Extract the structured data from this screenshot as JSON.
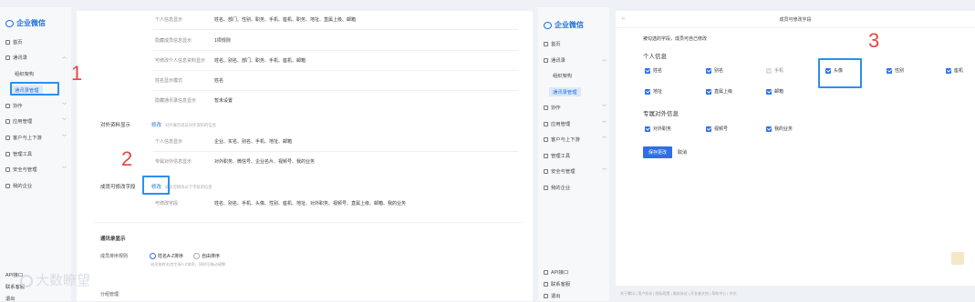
{
  "left": {
    "sidebar": {
      "brand": "企业微信",
      "items": [
        {
          "label": "首页"
        },
        {
          "label": "通讯录"
        },
        {
          "label": "组织架构"
        },
        {
          "label": "通讯录管理"
        },
        {
          "label": "协作"
        },
        {
          "label": "应用管理"
        },
        {
          "label": "客户与上下游"
        },
        {
          "label": "管理工具"
        },
        {
          "label": "安全与管理"
        },
        {
          "label": "我的企业"
        }
      ],
      "bottom": [
        "API接口",
        "联系客服",
        "退出"
      ]
    },
    "rows": [
      {
        "label": "个人信息显示",
        "value": "姓名、部门、性别、职务、手机、座机、职务、地址、直属上级、邮箱"
      },
      {
        "label": "隐藏成员信息显示",
        "value": "1项规则"
      },
      {
        "label": "可修改个人信息资料显示",
        "value": "姓名、别名、部门、职务、手机、座机、邮箱"
      },
      {
        "label": "姓名显示模式",
        "value": "姓名"
      },
      {
        "label": "隐藏通讯录信息显示",
        "value": "暂未设置"
      }
    ],
    "external": {
      "title": "对外资料显示",
      "edit": "修改",
      "hint": "对外展示成员对外资料的信息",
      "rows": [
        {
          "label": "个人信息显示",
          "value": "企业、实名、别名、手机、地址、邮箱"
        },
        {
          "label": "专属对外信息显示",
          "value": "对外职务、微信号、企业名片、视频号、我的业务"
        }
      ]
    },
    "member_edit": {
      "title": "成员可修改字段",
      "edit": "修改",
      "hint": "成员可修改以下字段的信息",
      "row_label": "可修改字段",
      "row_value": "姓名、别名、手机、头像、性别、座机、地址、对外职务、视频号、直属上级、邮箱、我的业务"
    },
    "sort": {
      "title": "通讯录显示",
      "label": "成员排序规则",
      "option1": "姓名A-Z排序",
      "option2": "自由排序",
      "hint": "成员按姓名首字母A-Z排序，同时可拖动调整"
    },
    "watermark": "大数瞭望",
    "bottom_link": "分组管理"
  },
  "annotations": {
    "one": "1",
    "two": "2",
    "three": "3"
  },
  "right": {
    "sidebar": {
      "brand": "企业微信",
      "items": [
        {
          "label": "首页"
        },
        {
          "label": "通讯录"
        },
        {
          "label": "组织架构"
        },
        {
          "label": "通讯录管理"
        },
        {
          "label": "协作"
        },
        {
          "label": "应用管理"
        },
        {
          "label": "客户与上下游"
        },
        {
          "label": "管理工具"
        },
        {
          "label": "安全与管理"
        },
        {
          "label": "我的企业"
        }
      ],
      "bottom": [
        "API接口",
        "联系客服",
        "退出"
      ]
    },
    "header_title": "成员可修改字段",
    "desc": "被勾选的字段，成员可自己修改",
    "personal_title": "个人信息",
    "personal_fields": [
      {
        "label": "姓名",
        "checked": true
      },
      {
        "label": "别名",
        "checked": true
      },
      {
        "label": "手机",
        "checked": false
      },
      {
        "label": "头像",
        "checked": true
      },
      {
        "label": "性别",
        "checked": true
      },
      {
        "label": "座机",
        "checked": true
      },
      {
        "label": "地址",
        "checked": true
      },
      {
        "label": "直属上级",
        "checked": true
      },
      {
        "label": "邮箱",
        "checked": true
      }
    ],
    "external_title": "专属对外信息",
    "external_fields": [
      {
        "label": "对外职务",
        "checked": true
      },
      {
        "label": "视频号",
        "checked": true
      },
      {
        "label": "我的业务",
        "checked": true
      }
    ],
    "save": "保存更改",
    "cancel": "取消",
    "footer": "关于腾讯 | 用户协议 | 隐私政策 | 服务协议 | 开发者文档 | 帮助中心 | 中文"
  },
  "colors": {
    "accent": "#2f6ee6",
    "annotation_red": "#e84545",
    "annotation_blue": "#2b8ff0"
  }
}
